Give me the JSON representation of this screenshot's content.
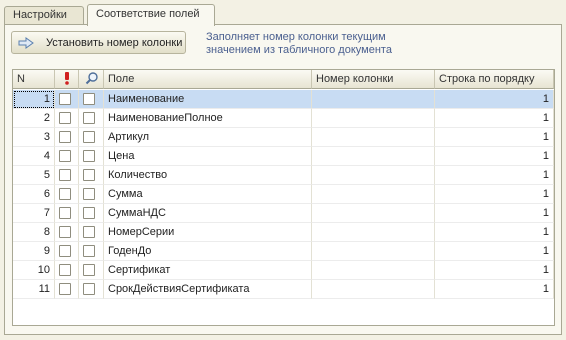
{
  "tabs": [
    {
      "label": "Настройки",
      "active": false
    },
    {
      "label": "Соответствие полей",
      "active": true
    }
  ],
  "toolbar": {
    "set_column_button": "Установить номер колонки",
    "set_column_icon": "arrow-right-icon",
    "hint": "Заполняет номер колонки текущим значением из табличного документа"
  },
  "table": {
    "columns": {
      "n": "N",
      "required_icon": "exclamation-icon",
      "search_icon": "magnifier-icon",
      "field": "Поле",
      "column_number": "Номер колонки",
      "row_order": "Строка по порядку"
    },
    "rows": [
      {
        "n": "1",
        "required": false,
        "search": false,
        "field": "Наименование",
        "column_number": "",
        "row_order": "1",
        "selected": true
      },
      {
        "n": "2",
        "required": false,
        "search": false,
        "field": "НаименованиеПолное",
        "column_number": "",
        "row_order": "1"
      },
      {
        "n": "3",
        "required": false,
        "search": false,
        "field": "Артикул",
        "column_number": "",
        "row_order": "1"
      },
      {
        "n": "4",
        "required": false,
        "search": false,
        "field": "Цена",
        "column_number": "",
        "row_order": "1"
      },
      {
        "n": "5",
        "required": false,
        "search": false,
        "field": "Количество",
        "column_number": "",
        "row_order": "1"
      },
      {
        "n": "6",
        "required": false,
        "search": false,
        "field": "Сумма",
        "column_number": "",
        "row_order": "1"
      },
      {
        "n": "7",
        "required": false,
        "search": false,
        "field": "СуммаНДС",
        "column_number": "",
        "row_order": "1"
      },
      {
        "n": "8",
        "required": false,
        "search": false,
        "field": "НомерСерии",
        "column_number": "",
        "row_order": "1"
      },
      {
        "n": "9",
        "required": false,
        "search": false,
        "field": "ГоденДо",
        "column_number": "",
        "row_order": "1"
      },
      {
        "n": "10",
        "required": false,
        "search": false,
        "field": "Сертификат",
        "column_number": "",
        "row_order": "1"
      },
      {
        "n": "11",
        "required": false,
        "search": false,
        "field": "СрокДействияСертификата",
        "column_number": "",
        "row_order": "1"
      }
    ]
  },
  "colors": {
    "selected_row": "#c8dcf3",
    "hint_text": "#4a5f8f",
    "required_icon": "#d02020"
  }
}
